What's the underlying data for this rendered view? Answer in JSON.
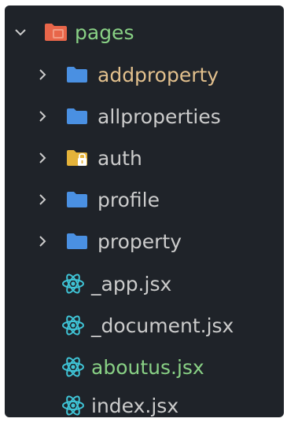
{
  "tree": {
    "root": {
      "label": "pages",
      "expanded": true,
      "label_color": "#89d185",
      "icon": "pages-folder-icon",
      "icon_color": "#e8664a"
    },
    "items": [
      {
        "label": "addproperty",
        "type": "folder",
        "expanded": false,
        "label_color": "#e2c08d",
        "icon": "folder-icon",
        "icon_color": "#4a90e2"
      },
      {
        "label": "allproperties",
        "type": "folder",
        "expanded": false,
        "label_color": "#cccccc",
        "icon": "folder-icon",
        "icon_color": "#4a90e2"
      },
      {
        "label": "auth",
        "type": "folder",
        "expanded": false,
        "label_color": "#cccccc",
        "icon": "lock-folder-icon",
        "icon_color": "#e5b33a"
      },
      {
        "label": "profile",
        "type": "folder",
        "expanded": false,
        "label_color": "#cccccc",
        "icon": "folder-icon",
        "icon_color": "#4a90e2"
      },
      {
        "label": "property",
        "type": "folder",
        "expanded": false,
        "label_color": "#cccccc",
        "icon": "folder-icon",
        "icon_color": "#4a90e2"
      },
      {
        "label": "_app.jsx",
        "type": "file",
        "label_color": "#cccccc",
        "icon": "react-icon",
        "icon_color": "#3fc4d6"
      },
      {
        "label": "_document.jsx",
        "type": "file",
        "label_color": "#cccccc",
        "icon": "react-icon",
        "icon_color": "#3fc4d6"
      },
      {
        "label": "aboutus.jsx",
        "type": "file",
        "label_color": "#89d185",
        "icon": "react-icon",
        "icon_color": "#3fc4d6"
      },
      {
        "label": "index.jsx",
        "type": "file",
        "label_color": "#cccccc",
        "icon": "react-icon",
        "icon_color": "#3fc4d6"
      }
    ]
  }
}
